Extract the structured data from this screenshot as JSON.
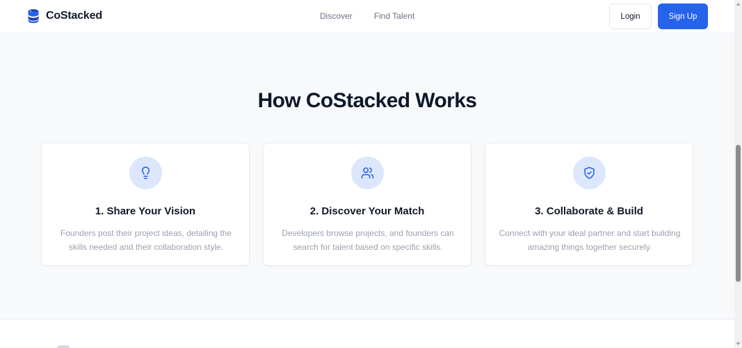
{
  "header": {
    "brand_name": "CoStacked",
    "nav": [
      "Discover",
      "Find Talent"
    ],
    "login_label": "Login",
    "signup_label": "Sign Up"
  },
  "section": {
    "title": "How CoStacked Works",
    "cards": [
      {
        "icon": "lightbulb-icon",
        "title": "1. Share Your Vision",
        "description": "Founders post their project ideas, detailing the skills needed and their collaboration style."
      },
      {
        "icon": "users-icon",
        "title": "2. Discover Your Match",
        "description": "Developers browse projects, and founders can search for talent based on specific skills."
      },
      {
        "icon": "shield-check-icon",
        "title": "3. Collaborate & Build",
        "description": "Connect with your ideal partner and start building amazing things together securely."
      }
    ]
  },
  "colors": {
    "accent": "#2563eb",
    "icon_bg": "#dde7fb",
    "page_bg": "#f8f9fb",
    "heading": "#0f172a",
    "muted_text": "#9aa1ad"
  }
}
